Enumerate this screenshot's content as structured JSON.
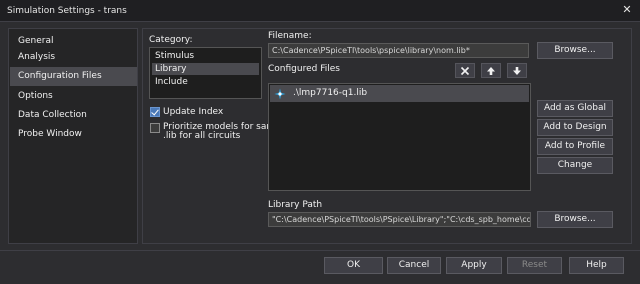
{
  "window": {
    "title": "Simulation Settings - trans",
    "close_glyph": "✕"
  },
  "nav": {
    "items": [
      {
        "label": "General"
      },
      {
        "label": "Analysis"
      },
      {
        "label": "Configuration Files",
        "active": true
      },
      {
        "label": "Options"
      },
      {
        "label": "Data Collection"
      },
      {
        "label": "Probe Window"
      }
    ]
  },
  "category": {
    "label": "Category:",
    "items": [
      {
        "label": "Stimulus"
      },
      {
        "label": "Library",
        "selected": true
      },
      {
        "label": "Include"
      }
    ]
  },
  "options": {
    "update_index": {
      "label": "Update Index",
      "checked": true
    },
    "prioritize": {
      "label_line1": "Prioritize models for same",
      "label_line2": ".lib for all circuits",
      "checked": false
    }
  },
  "filename": {
    "label": "Filename:",
    "value": "C:\\Cadence\\PSpiceTI\\tools\\pspice\\library\\nom.lib*",
    "browse": "Browse..."
  },
  "configured": {
    "label": "Configured Files",
    "delete_icon": "delete-icon",
    "up_icon": "arrow-up-icon",
    "down_icon": "arrow-down-icon",
    "files": [
      {
        "name": ".\\lmp7716-q1.lib"
      }
    ]
  },
  "side_buttons": {
    "add_global": "Add as Global",
    "add_design": "Add to Design",
    "add_profile": "Add to Profile",
    "change": "Change"
  },
  "library_path": {
    "label": "Library Path",
    "value": "\"C:\\Cadence\\PSpiceTI\\tools\\PSpice\\Library\";\"C:\\cds_spb_home\\cdssetup",
    "browse": "Browse..."
  },
  "footer": {
    "ok": "OK",
    "cancel": "Cancel",
    "apply": "Apply",
    "reset": "Reset",
    "help": "Help"
  },
  "colors": {
    "background": "#2d2d30",
    "selection": "#4a4a4f",
    "check_accent": "#4a79b8",
    "file_icon": "#2f9fd8"
  }
}
